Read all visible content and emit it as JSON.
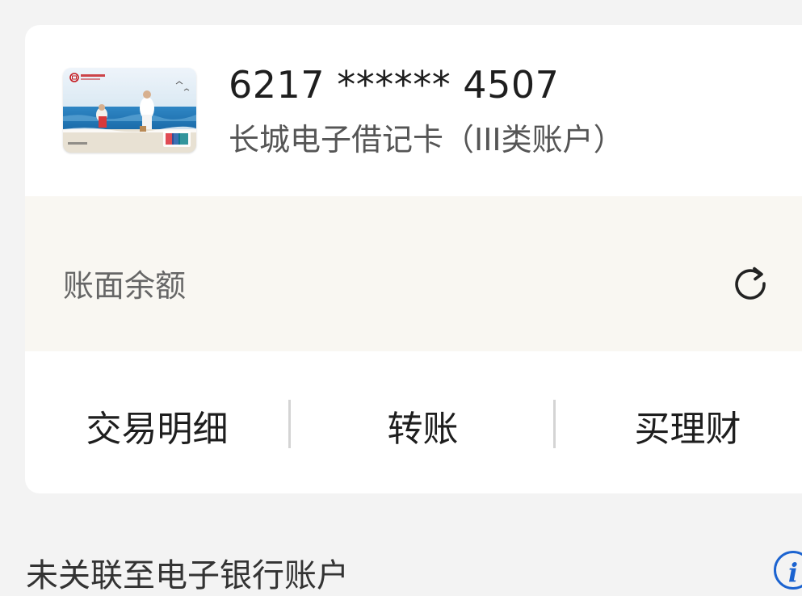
{
  "card": {
    "number": "6217 ****** 4507",
    "type": "长城电子借记卡（III类账户）"
  },
  "balance": {
    "label": "账面余额"
  },
  "actions": {
    "transactions": "交易明细",
    "transfer": "转账",
    "wealth": "买理财"
  },
  "below": {
    "title": "未关联至电子银行账户"
  },
  "icons": {
    "refresh": "refresh-icon",
    "info": "info-icon"
  },
  "colors": {
    "page_bg": "#f3f3f3",
    "card_bg": "#ffffff",
    "balance_bg": "#f9f7f2",
    "info_accent": "#1b63d0"
  }
}
